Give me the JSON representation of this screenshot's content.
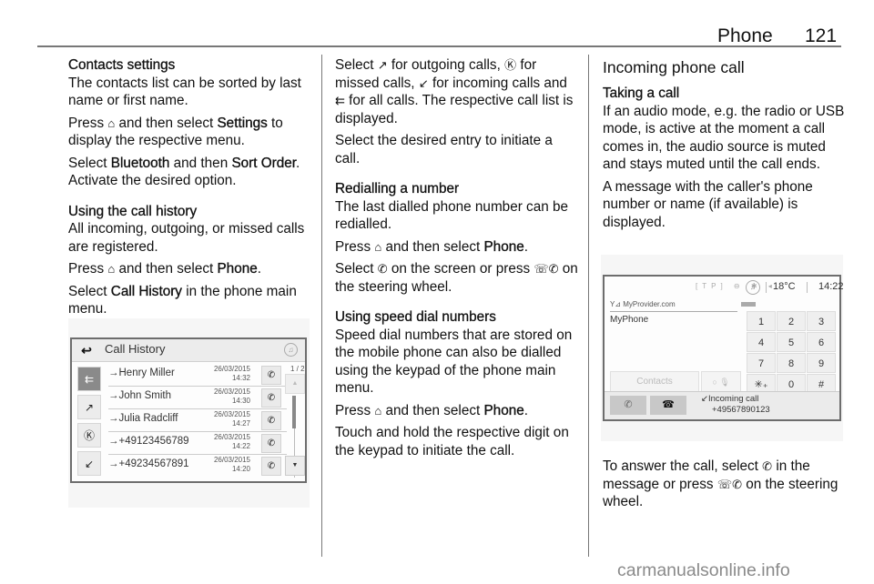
{
  "header": {
    "title": "Phone",
    "page_number": "121"
  },
  "col1": {
    "contacts_settings_heading": "Contacts settings",
    "contacts_settings_text": "The contacts list can be sorted by last name or first name.",
    "press1_a": "Press",
    "press1_icon": "⌂",
    "press1_b": "and then select",
    "press1_bold": "Settings",
    "press1_c": "to display the respective menu.",
    "select1_a": "Select",
    "select1_bold1": "Bluetooth",
    "select1_b": "and then",
    "select1_bold2": "Sort Order",
    "select1_c": ". Activate the desired option.",
    "call_history_heading": "Using the call history",
    "call_history_text": "All incoming, outgoing, or missed calls are registered.",
    "press2_a": "Press",
    "press2_icon": "⌂",
    "press2_b": "and then select",
    "press2_bold": "Phone",
    "press2_c": ".",
    "select2_a": "Select",
    "select2_bold": "Call History",
    "select2_b": "in the phone main menu."
  },
  "call_history_screen": {
    "back_icon": "↩",
    "title": "Call History",
    "music_icon": "♫",
    "page_indicator": "1 / 2",
    "filters": [
      {
        "name": "all-calls",
        "icon": "⇇",
        "active": true
      },
      {
        "name": "outgoing-calls",
        "icon": "↗",
        "active": false
      },
      {
        "name": "missed-calls",
        "icon": "Ⓚ",
        "active": false
      },
      {
        "name": "incoming-calls",
        "icon": "↙",
        "active": false
      }
    ],
    "entries": [
      {
        "name": "→Henry Miller",
        "date": "26/03/2015",
        "time": "14:32"
      },
      {
        "name": "→John Smith",
        "date": "26/03/2015",
        "time": "14:30"
      },
      {
        "name": "→Julia Radcliff",
        "date": "26/03/2015",
        "time": "14:27"
      },
      {
        "name": "→+49123456789",
        "date": "26/03/2015",
        "time": "14:22"
      },
      {
        "name": "→+49234567891",
        "date": "26/03/2015",
        "time": "14:20"
      }
    ],
    "call_icon": "✆",
    "scroll_up": "▲",
    "scroll_down": "▼"
  },
  "col2": {
    "select_a": "Select",
    "outgoing_icon": "↗",
    "select_b": "for outgoing calls,",
    "missed_icon": "Ⓚ",
    "select_c": "for missed calls,",
    "incoming_icon": "↙",
    "select_d": "for incoming calls and",
    "all_icon": "⇇",
    "select_e": "for all calls. The respective call list is displayed.",
    "select_entry": "Select the desired entry to initiate a call.",
    "redial_heading": "Redialling a number",
    "redial_text": "The last dialled phone number can be redialled.",
    "press1_a": "Press",
    "press1_icon": "⌂",
    "press1_b": "and then select",
    "press1_bold": "Phone",
    "press1_c": ".",
    "select2_a": "Select",
    "select2_icon": "✆",
    "select2_b": "on the screen or press",
    "steering_icon": "☏✆",
    "select2_c": "on the steering wheel.",
    "speed_heading": "Using speed dial numbers",
    "speed_text": "Speed dial numbers that are stored on the mobile phone can also be dialled using the keypad of the phone main menu.",
    "press2_a": "Press",
    "press2_icon": "⌂",
    "press2_b": "and then select",
    "press2_bold": "Phone",
    "press2_c": ".",
    "touch_text": "Touch and hold the respective digit on the keypad to initiate the call."
  },
  "col3": {
    "section_heading": "Incoming phone call",
    "taking_heading": "Taking a call",
    "taking_text": "If an audio mode, e.g. the radio or USB mode, is active at the moment a call comes in, the audio source is muted and stays muted until the call ends.",
    "message_text": "A message with the caller's phone number or name (if available) is displayed.",
    "answer_a": "To answer the call, select",
    "answer_icon": "✆",
    "answer_b": "in the message or press",
    "steering_icon": "☏✆",
    "answer_c": "on the steering wheel."
  },
  "incoming_call_screen": {
    "status_icons": "[TP] ⊖ ✱ ◂",
    "music_icon": "♫",
    "temperature": "18°C",
    "time": "14:22",
    "provider": "Y⊿ MyProvider.com",
    "phone_name": "MyPhone",
    "keypad": [
      "1",
      "2",
      "3",
      "4",
      "5",
      "6",
      "7",
      "8",
      "9",
      "✳₊",
      "0",
      "#"
    ],
    "contacts_button": "Contacts",
    "mute_button": "○ 🎙",
    "answer_icon": "✆",
    "reject_icon": "☎",
    "incoming_label": "↙Incoming call",
    "caller_number": "+49567890123"
  },
  "watermark": "carmanualsonline.info"
}
